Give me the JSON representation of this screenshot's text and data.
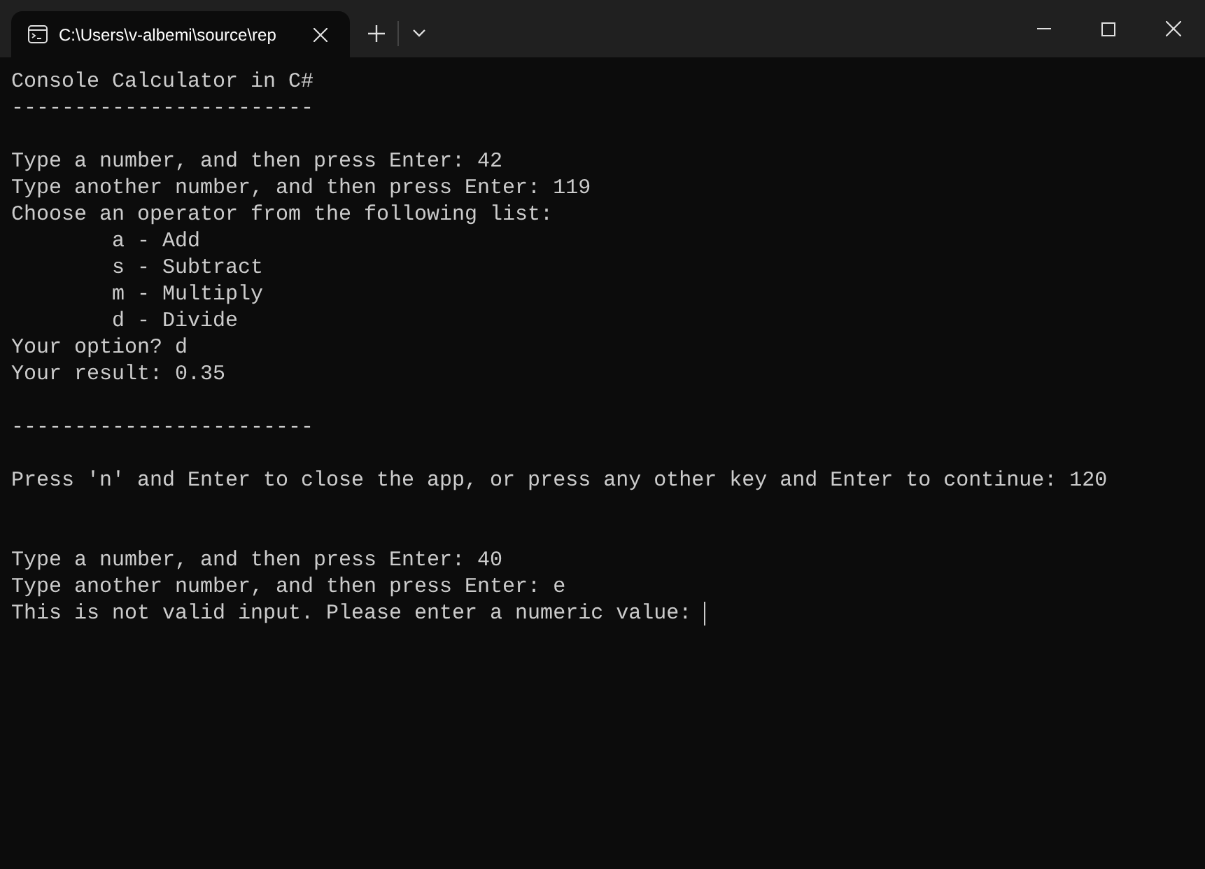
{
  "window": {
    "tabs": [
      {
        "title": "C:\\Users\\v-albemi\\source\\rep",
        "selected": true
      }
    ]
  },
  "console": {
    "lines": [
      {
        "kind": "text",
        "text": "Console Calculator in C#"
      },
      {
        "kind": "text",
        "text": "------------------------"
      },
      {
        "kind": "blank"
      },
      {
        "kind": "text",
        "text": "Type a number, and then press Enter: 42"
      },
      {
        "kind": "text",
        "text": "Type another number, and then press Enter: 119"
      },
      {
        "kind": "text",
        "text": "Choose an operator from the following list:"
      },
      {
        "kind": "text",
        "text": "\ta - Add"
      },
      {
        "kind": "text",
        "text": "\ts - Subtract"
      },
      {
        "kind": "text",
        "text": "\tm - Multiply"
      },
      {
        "kind": "text",
        "text": "\td - Divide"
      },
      {
        "kind": "text",
        "text": "Your option? d"
      },
      {
        "kind": "text",
        "text": "Your result: 0.35"
      },
      {
        "kind": "blank"
      },
      {
        "kind": "text",
        "text": "------------------------"
      },
      {
        "kind": "blank"
      },
      {
        "kind": "text",
        "text": "Press 'n' and Enter to close the app, or press any other key and Enter to continue: 120"
      },
      {
        "kind": "blank"
      },
      {
        "kind": "blank"
      },
      {
        "kind": "text",
        "text": "Type a number, and then press Enter: 40"
      },
      {
        "kind": "text",
        "text": "Type another number, and then press Enter: e"
      },
      {
        "kind": "text",
        "text": "This is not valid input. Please enter a numeric value: ",
        "cursor": true
      }
    ]
  }
}
